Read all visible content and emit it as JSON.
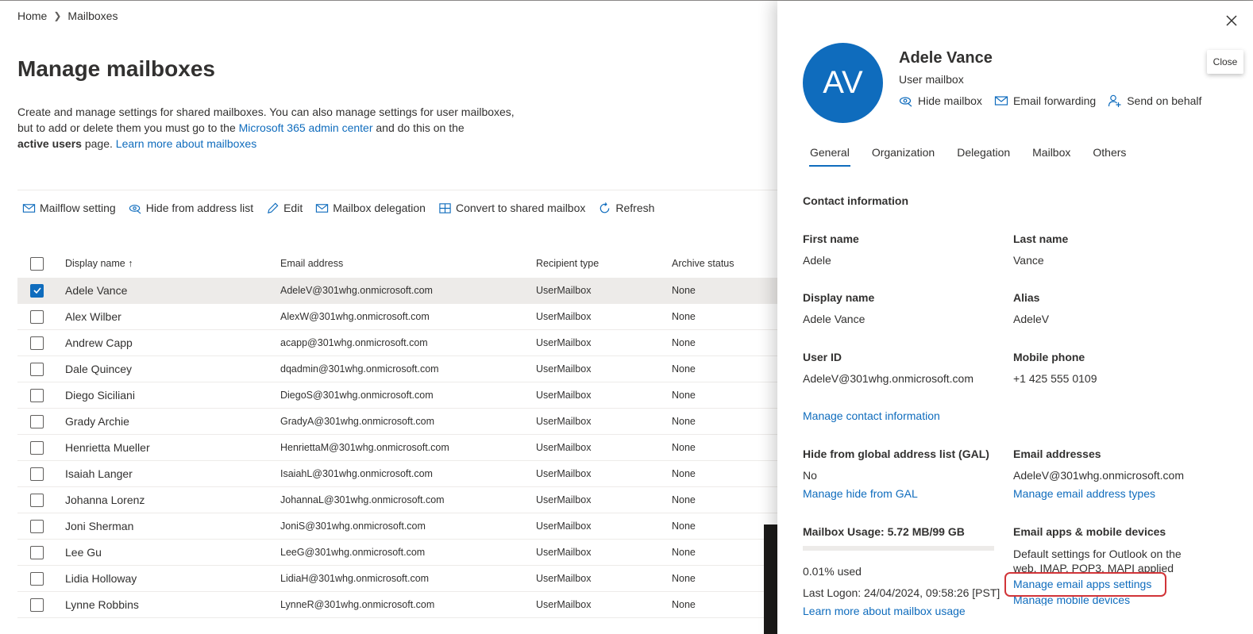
{
  "breadcrumb": {
    "home": "Home",
    "current": "Mailboxes"
  },
  "page": {
    "title": "Manage mailboxes",
    "desc1": "Create and manage settings for shared mailboxes. You can also manage settings for user mailboxes,",
    "desc2a": "but to add or delete them you must go to the ",
    "desc2link": "Microsoft 365 admin center",
    "desc2b": " and do this on the",
    "desc3bold": "active users",
    "desc3a": " page. ",
    "desc3link": "Learn more about mailboxes"
  },
  "toolbar": {
    "mailflow": "Mailflow setting",
    "hide": "Hide from address list",
    "edit": "Edit",
    "delegation": "Mailbox delegation",
    "convert": "Convert to shared mailbox",
    "refresh": "Refresh"
  },
  "table": {
    "headers": {
      "name": "Display name",
      "sort_arrow": "↑",
      "email": "Email address",
      "type": "Recipient type",
      "archive": "Archive status"
    },
    "rows": [
      {
        "name": "Adele Vance",
        "email": "AdeleV@301whg.onmicrosoft.com",
        "type": "UserMailbox",
        "archive": "None",
        "checked": true
      },
      {
        "name": "Alex Wilber",
        "email": "AlexW@301whg.onmicrosoft.com",
        "type": "UserMailbox",
        "archive": "None"
      },
      {
        "name": "Andrew Capp",
        "email": "acapp@301whg.onmicrosoft.com",
        "type": "UserMailbox",
        "archive": "None"
      },
      {
        "name": "Dale Quincey",
        "email": "dqadmin@301whg.onmicrosoft.com",
        "type": "UserMailbox",
        "archive": "None"
      },
      {
        "name": "Diego Siciliani",
        "email": "DiegoS@301whg.onmicrosoft.com",
        "type": "UserMailbox",
        "archive": "None"
      },
      {
        "name": "Grady Archie",
        "email": "GradyA@301whg.onmicrosoft.com",
        "type": "UserMailbox",
        "archive": "None"
      },
      {
        "name": "Henrietta Mueller",
        "email": "HenriettaM@301whg.onmicrosoft.com",
        "type": "UserMailbox",
        "archive": "None"
      },
      {
        "name": "Isaiah Langer",
        "email": "IsaiahL@301whg.onmicrosoft.com",
        "type": "UserMailbox",
        "archive": "None"
      },
      {
        "name": "Johanna Lorenz",
        "email": "JohannaL@301whg.onmicrosoft.com",
        "type": "UserMailbox",
        "archive": "None"
      },
      {
        "name": "Joni Sherman",
        "email": "JoniS@301whg.onmicrosoft.com",
        "type": "UserMailbox",
        "archive": "None"
      },
      {
        "name": "Lee Gu",
        "email": "LeeG@301whg.onmicrosoft.com",
        "type": "UserMailbox",
        "archive": "None"
      },
      {
        "name": "Lidia Holloway",
        "email": "LidiaH@301whg.onmicrosoft.com",
        "type": "UserMailbox",
        "archive": "None"
      },
      {
        "name": "Lynne Robbins",
        "email": "LynneR@301whg.onmicrosoft.com",
        "type": "UserMailbox",
        "archive": "None"
      }
    ]
  },
  "panel": {
    "close_tooltip": "Close",
    "initials": "AV",
    "name": "Adele Vance",
    "subtitle": "User mailbox",
    "actions": {
      "hide": "Hide mailbox",
      "forwarding": "Email forwarding",
      "send_behalf": "Send on behalf"
    },
    "tabs": [
      "General",
      "Organization",
      "Delegation",
      "Mailbox",
      "Others"
    ],
    "section_title": "Contact information",
    "first_name_label": "First name",
    "first_name": "Adele",
    "last_name_label": "Last name",
    "last_name": "Vance",
    "display_name_label": "Display name",
    "display_name": "Adele Vance",
    "alias_label": "Alias",
    "alias": "AdeleV",
    "user_id_label": "User ID",
    "user_id": "AdeleV@301whg.onmicrosoft.com",
    "mobile_label": "Mobile phone",
    "mobile": "+1 425 555 0109",
    "manage_contact": "Manage contact information",
    "gal_label": "Hide from global address list (GAL)",
    "gal_value": "No",
    "manage_gal": "Manage hide from GAL",
    "email_addr_label": "Email addresses",
    "email_addr": "AdeleV@301whg.onmicrosoft.com",
    "manage_email_types": "Manage email address types",
    "usage_label": "Mailbox Usage: 5.72 MB/99 GB",
    "usage_fraction": 0.0001,
    "usage_pct": "0.01% used",
    "last_logon": "Last Logon: 24/04/2024, 09:58:26 [PST]",
    "learn_usage": "Learn more about mailbox usage",
    "apps_label": "Email apps & mobile devices",
    "apps_desc1": "Default settings for Outlook on the",
    "apps_desc2": "web, IMAP, POP3, MAPI applied",
    "manage_apps": "Manage email apps settings",
    "manage_devices": "Manage mobile devices"
  },
  "colors": {
    "accent": "#0f6cbd",
    "highlight": "#d13438"
  }
}
